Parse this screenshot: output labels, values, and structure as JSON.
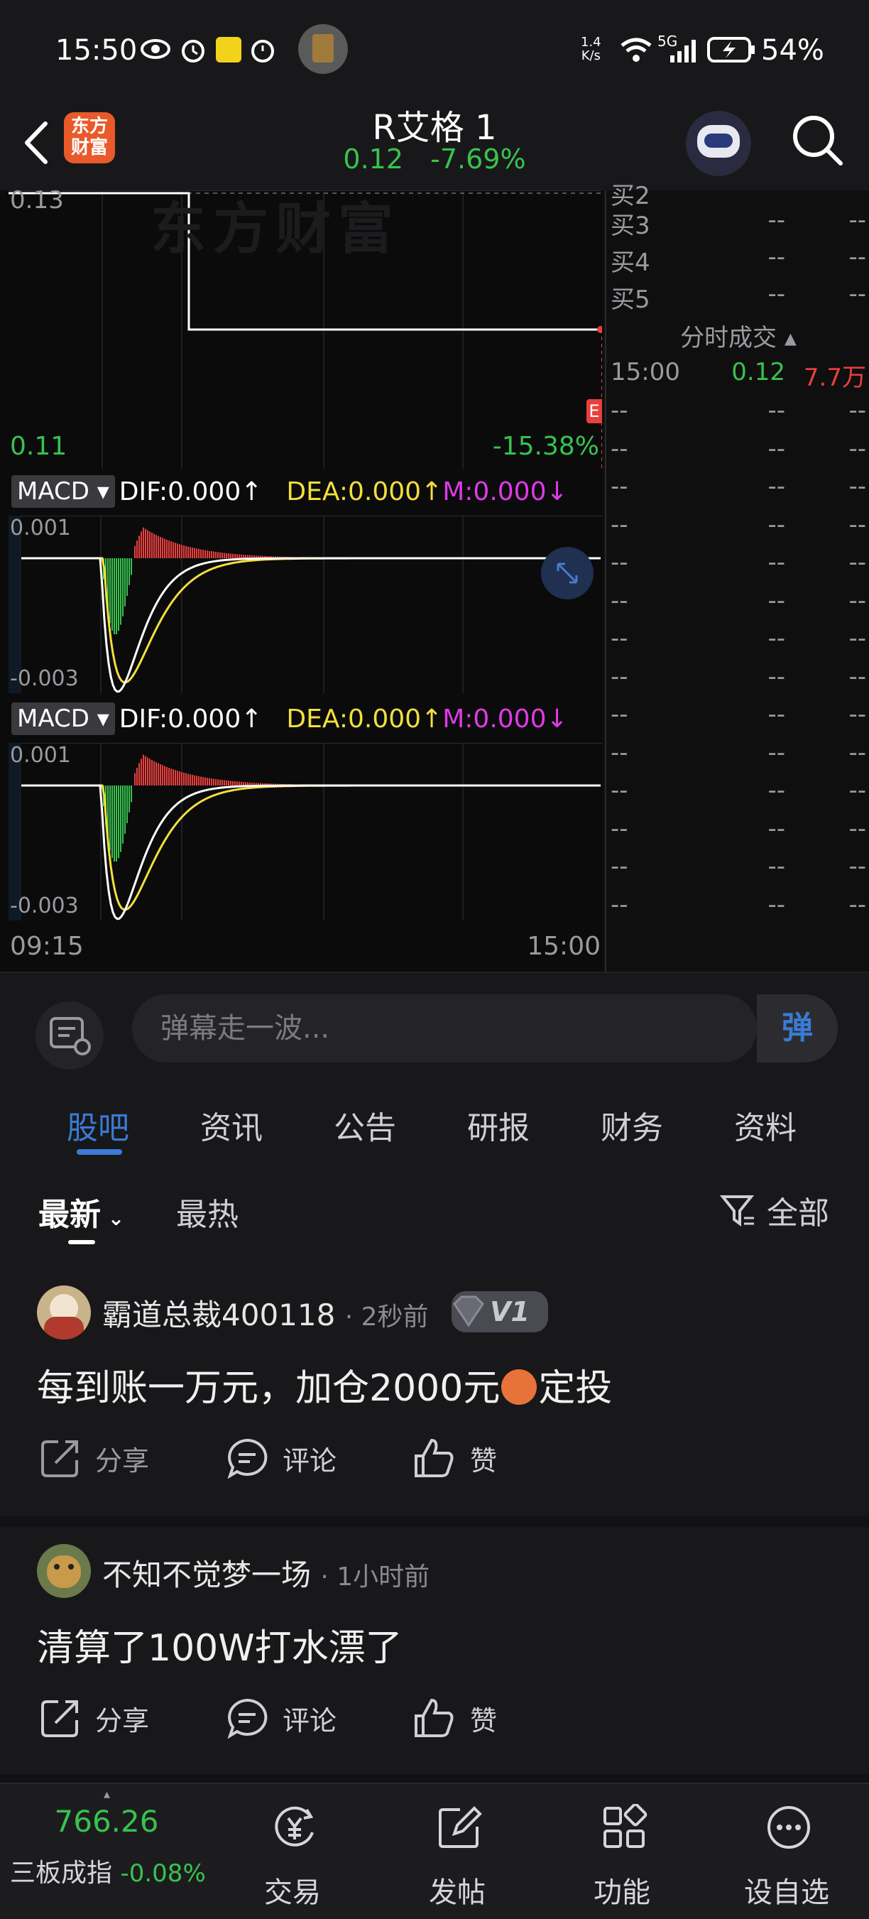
{
  "status_bar": {
    "time": "15:50",
    "net_speed_top": "1.4",
    "net_speed_bottom": "K/s",
    "network": "5G",
    "battery": "54%"
  },
  "header": {
    "brand_line1": "东方",
    "brand_line2": "财富",
    "stock_name": "R艾格 1",
    "price": "0.12",
    "change_pct": "-7.69%"
  },
  "price_chart": {
    "top_label": "0.13",
    "low_label": "0.11",
    "low_pct": "-15.38%",
    "marker": "E",
    "watermark": "东方财富"
  },
  "macd_panels": [
    {
      "chip": "MACD",
      "dif": "DIF:0.000↑",
      "dea": "DEA:0.000↑",
      "m": "M:0.000↓",
      "y_top": "0.001",
      "y_bottom": "-0.003"
    },
    {
      "chip": "MACD",
      "dif": "DIF:0.000↑",
      "dea": "DEA:0.000↑",
      "m": "M:0.000↓",
      "y_top": "0.001",
      "y_bottom": "-0.003"
    }
  ],
  "time_axis": {
    "start": "09:15",
    "end": "15:00"
  },
  "order_book": {
    "rows": [
      {
        "label": "买2",
        "a": "",
        "b": ""
      },
      {
        "label": "买3",
        "a": "--",
        "b": "--"
      },
      {
        "label": "买4",
        "a": "--",
        "b": "--"
      },
      {
        "label": "买5",
        "a": "--",
        "b": "--"
      }
    ],
    "trades_header": "分时成交",
    "first_trade": {
      "time": "15:00",
      "price": "0.12",
      "volume": "7.7万"
    },
    "empty_row_count": 14,
    "empty_value": "--"
  },
  "danmaku": {
    "placeholder": "弹幕走一波...",
    "send_label": "弹"
  },
  "tabs": [
    {
      "label": "股吧",
      "active": true
    },
    {
      "label": "资讯",
      "active": false
    },
    {
      "label": "公告",
      "active": false
    },
    {
      "label": "研报",
      "active": false
    },
    {
      "label": "财务",
      "active": false
    },
    {
      "label": "资料",
      "active": false
    }
  ],
  "sort_bar": {
    "latest": "最新",
    "hottest": "最热",
    "filter": "全部"
  },
  "posts": [
    {
      "author": "霸道总裁400118",
      "time": "2秒前",
      "level": "V1",
      "text_before_emoji": "每到账一万元，加仓2000元",
      "text_after_emoji": "定投",
      "share": "分享",
      "comment": "评论",
      "like": "赞"
    },
    {
      "author": "不知不觉梦一场",
      "time": "1小时前",
      "text": "清算了100W打水漂了",
      "share": "分享",
      "comment": "评论",
      "like": "赞"
    }
  ],
  "bottom_nav": {
    "index_value": "766.26",
    "index_name": "三板成指",
    "index_change": "-0.08%",
    "trade": "交易",
    "post": "发帖",
    "functions": "功能",
    "watchlist": "设自选"
  },
  "colors": {
    "up": "#e8403d",
    "down": "#38c24e",
    "dea": "#f2df3c",
    "m": "#e03ae6",
    "accent": "#3a7bd5"
  }
}
